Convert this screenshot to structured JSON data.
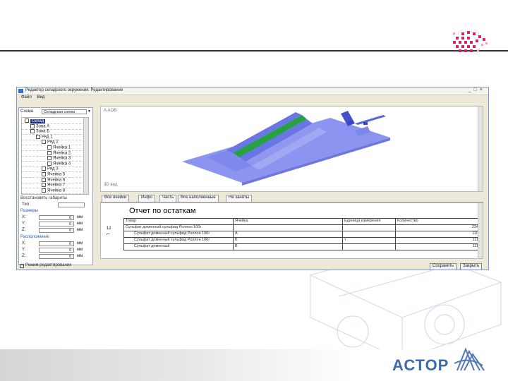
{
  "slide": {
    "brand": "АСТОР"
  },
  "window": {
    "title": "Редактор складского окружения: Редактирование",
    "menu": [
      "Файл",
      "Вид"
    ],
    "left_panel": {
      "scheme_label": "Схема",
      "scheme_value": "Складская схема",
      "tree_items": [
        {
          "label": "Склад",
          "level": 0,
          "selected": true
        },
        {
          "label": "Зона А",
          "level": 1
        },
        {
          "label": "Зона Б",
          "level": 1
        },
        {
          "label": "Ряд 1",
          "level": 2
        },
        {
          "label": "Ряд 2",
          "level": 3
        },
        {
          "label": "Ячейка 1",
          "level": 4
        },
        {
          "label": "Ячейка 2",
          "level": 4
        },
        {
          "label": "Ячейка 3",
          "level": 4
        },
        {
          "label": "Ячейка 4",
          "level": 4
        },
        {
          "label": "Ряд 3",
          "level": 3
        },
        {
          "label": "Ячейка 5",
          "level": 3
        },
        {
          "label": "Ячейка 6",
          "level": 3
        },
        {
          "label": "Ячейка 7",
          "level": 3
        },
        {
          "label": "Ячейка 8",
          "level": 3
        }
      ],
      "section_size": "Восстановить габариты",
      "type_label": "Тип",
      "size_header": "Размеры",
      "size_fields": [
        {
          "label": "X:",
          "value": "0",
          "unit": "мм"
        },
        {
          "label": "Y:",
          "value": "0",
          "unit": "мм"
        },
        {
          "label": "Z:",
          "value": "0",
          "unit": "мм"
        }
      ],
      "position_header": "Расположение",
      "position_fields": [
        {
          "label": "X:",
          "value": "0",
          "unit": "мм"
        },
        {
          "label": "Y:",
          "value": "0",
          "unit": "мм"
        },
        {
          "label": "Z:",
          "value": "0",
          "unit": "мм"
        }
      ]
    },
    "view3d": {
      "top_label": "А:АОВ",
      "bottom_label": "3D вид"
    },
    "tabs": [
      "Все ячейки",
      "Инфо",
      "Часть",
      "Все наполненные",
      "Не заняты"
    ],
    "report": {
      "title": "Отчет по остаткам",
      "columns": [
        "Товар",
        "Ячейка",
        "Единица измерения",
        "Количество"
      ],
      "rows": [
        {
          "cells": [
            "Сульфат доменный сульфид Роллон 100г",
            "",
            "",
            "234"
          ]
        },
        {
          "cells": [
            "Сульфат доменный сульфид Роллон 100г",
            "А",
            "",
            "110"
          ]
        },
        {
          "cells": [
            "Сульфат доменный сульфид Роллон 100г",
            "Б",
            "т",
            "111"
          ]
        },
        {
          "cells": [
            "Сульфат доменный",
            "В",
            "",
            "111"
          ]
        }
      ]
    },
    "status": {
      "checkbox_label": "Режим редактирования",
      "ok_button": "Сохранить",
      "cancel_button": "Закрыть"
    }
  }
}
